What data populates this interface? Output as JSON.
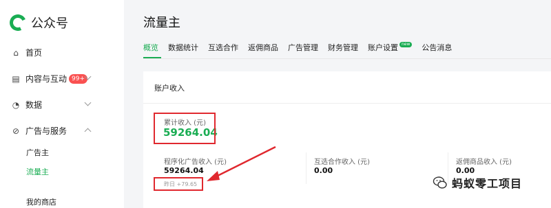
{
  "brand": {
    "name": "公众号",
    "color": "#1aad53"
  },
  "sidebar": {
    "items": [
      {
        "label": "首页",
        "icon": "home-icon"
      },
      {
        "label": "内容与互动",
        "badge": "99+",
        "icon": "document-icon"
      },
      {
        "label": "数据",
        "icon": "clock-icon"
      },
      {
        "label": "广告与服务",
        "icon": "compass-icon"
      }
    ],
    "sub_items": [
      {
        "label": "广告主"
      },
      {
        "label": "流量主",
        "active": true
      },
      {
        "label": "我的商店"
      }
    ]
  },
  "main": {
    "title": "流量主",
    "tabs": [
      {
        "label": "概览",
        "active": true
      },
      {
        "label": "数据统计"
      },
      {
        "label": "互选合作"
      },
      {
        "label": "返佣商品"
      },
      {
        "label": "广告管理"
      },
      {
        "label": "财务管理"
      },
      {
        "label": "账户设置",
        "badge": "new"
      },
      {
        "label": "公告消息"
      }
    ]
  },
  "income": {
    "title": "账户收入",
    "total_label": "累计收入 (元)",
    "total_value": "59264.04",
    "metrics": [
      {
        "label": "程序化广告收入 (元)",
        "value": "59264.04",
        "sub": "昨日 +79.65"
      },
      {
        "label": "互选合作收入 (元)",
        "value": "0.00"
      },
      {
        "label": "返佣商品收入 (元)",
        "value": "0.00"
      }
    ]
  },
  "watermark": {
    "text": "蚂蚁零工项目"
  },
  "colors": {
    "accent": "#1aad53",
    "highlight": "#e0282e",
    "badge": "#fa5151"
  }
}
